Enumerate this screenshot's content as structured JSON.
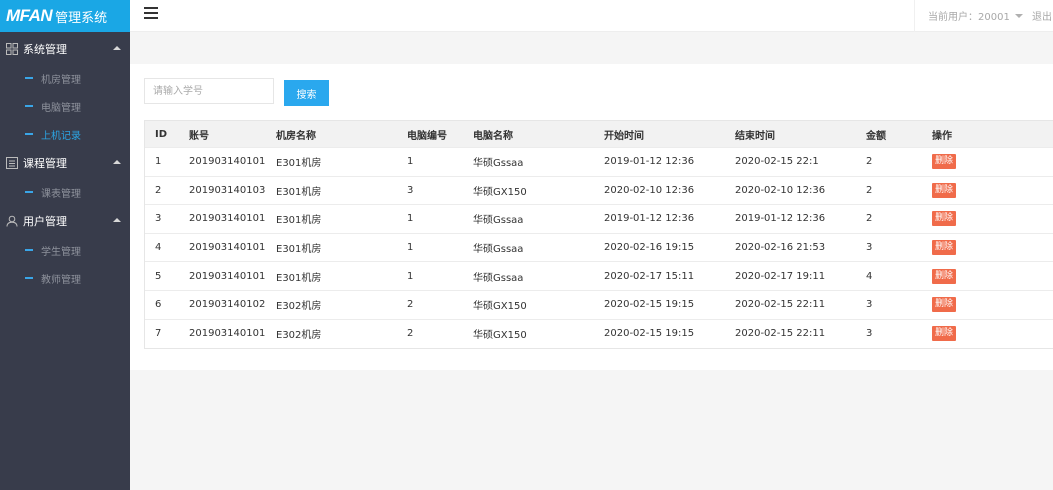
{
  "app": {
    "logo_mark": "MFAN",
    "logo_text": "管理系统"
  },
  "header": {
    "current_user": "当前用户：20001",
    "logout": "退出"
  },
  "sidebar": {
    "groups": [
      {
        "label": "系统管理",
        "icon": "grid-icon",
        "items": [
          {
            "label": "机房管理",
            "active": false
          },
          {
            "label": "电脑管理",
            "active": false
          },
          {
            "label": "上机记录",
            "active": true
          }
        ]
      },
      {
        "label": "课程管理",
        "icon": "list-icon",
        "items": [
          {
            "label": "课表管理",
            "active": false
          }
        ]
      },
      {
        "label": "用户管理",
        "icon": "user-icon",
        "items": [
          {
            "label": "学生管理",
            "active": false
          },
          {
            "label": "教师管理",
            "active": false
          }
        ]
      }
    ]
  },
  "search": {
    "placeholder": "请输入学号",
    "button": "搜索"
  },
  "table": {
    "columns": [
      "ID",
      "账号",
      "机房名称",
      "电脑编号",
      "电脑名称",
      "开始时间",
      "结束时间",
      "金额",
      "操作"
    ],
    "delete_label": "删除",
    "rows": [
      [
        "1",
        "201903140101",
        "E301机房",
        "1",
        "华硕Gssaa",
        "2019-01-12 12:36",
        "2020-02-15 22:1",
        "2"
      ],
      [
        "2",
        "201903140103",
        "E301机房",
        "3",
        "华硕GX150",
        "2020-02-10 12:36",
        "2020-02-10 12:36",
        "2"
      ],
      [
        "3",
        "201903140101",
        "E301机房",
        "1",
        "华硕Gssaa",
        "2019-01-12 12:36",
        "2019-01-12 12:36",
        "2"
      ],
      [
        "4",
        "201903140101",
        "E301机房",
        "1",
        "华硕Gssaa",
        "2020-02-16 19:15",
        "2020-02-16 21:53",
        "3"
      ],
      [
        "5",
        "201903140101",
        "E301机房",
        "1",
        "华硕Gssaa",
        "2020-02-17 15:11",
        "2020-02-17 19:11",
        "4"
      ],
      [
        "6",
        "201903140102",
        "E302机房",
        "2",
        "华硕GX150",
        "2020-02-15 19:15",
        "2020-02-15 22:11",
        "3"
      ],
      [
        "7",
        "201903140101",
        "E302机房",
        "2",
        "华硕GX150",
        "2020-02-15 19:15",
        "2020-02-15 22:11",
        "3"
      ]
    ]
  },
  "colors": {
    "brand": "#1aa7e5",
    "sidebar_bg": "#383c4b",
    "active_item": "#2ba5e4",
    "delete": "#f06b4a"
  }
}
